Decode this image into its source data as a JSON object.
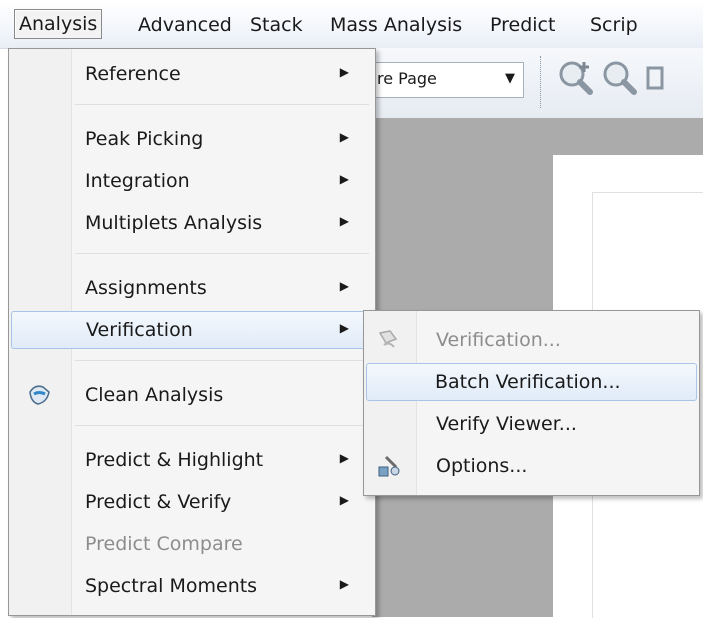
{
  "menubar": {
    "items": [
      "Analysis",
      "Advanced",
      "Stack",
      "Mass Analysis",
      "Predict",
      "Scrip"
    ]
  },
  "toolbar": {
    "zoom_value": "re Page",
    "zoom_arrow": "▼"
  },
  "main_menu": {
    "items": [
      {
        "label": "Reference",
        "arrow": "▶"
      },
      {
        "label": "Peak Picking",
        "arrow": "▶"
      },
      {
        "label": "Integration",
        "arrow": "▶"
      },
      {
        "label": "Multiplets Analysis",
        "arrow": "▶"
      },
      {
        "label": "Assignments",
        "arrow": "▶"
      },
      {
        "label": "Verification",
        "arrow": "▶"
      },
      {
        "label": "Clean Analysis",
        "icon": "broom-icon"
      },
      {
        "label": "Predict & Highlight",
        "arrow": "▶"
      },
      {
        "label": "Predict & Verify",
        "arrow": "▶"
      },
      {
        "label": "Predict  Compare",
        "disabled": true
      },
      {
        "label": "Spectral Moments",
        "arrow": "▶"
      }
    ]
  },
  "sub_menu": {
    "items": [
      {
        "label": "Verification...",
        "disabled": true,
        "icon": "verification-icon"
      },
      {
        "label": "Batch Verification..."
      },
      {
        "label": "Verify Viewer..."
      },
      {
        "label": "Options...",
        "icon": "options-icon"
      }
    ]
  },
  "colors": {
    "menu_background": "#f5f5f5",
    "hover_border": "#a9c4e6",
    "hover_fill": "#e0ebf8",
    "disabled_text": "#8d8d8d",
    "workspace_gray": "#ababab"
  }
}
